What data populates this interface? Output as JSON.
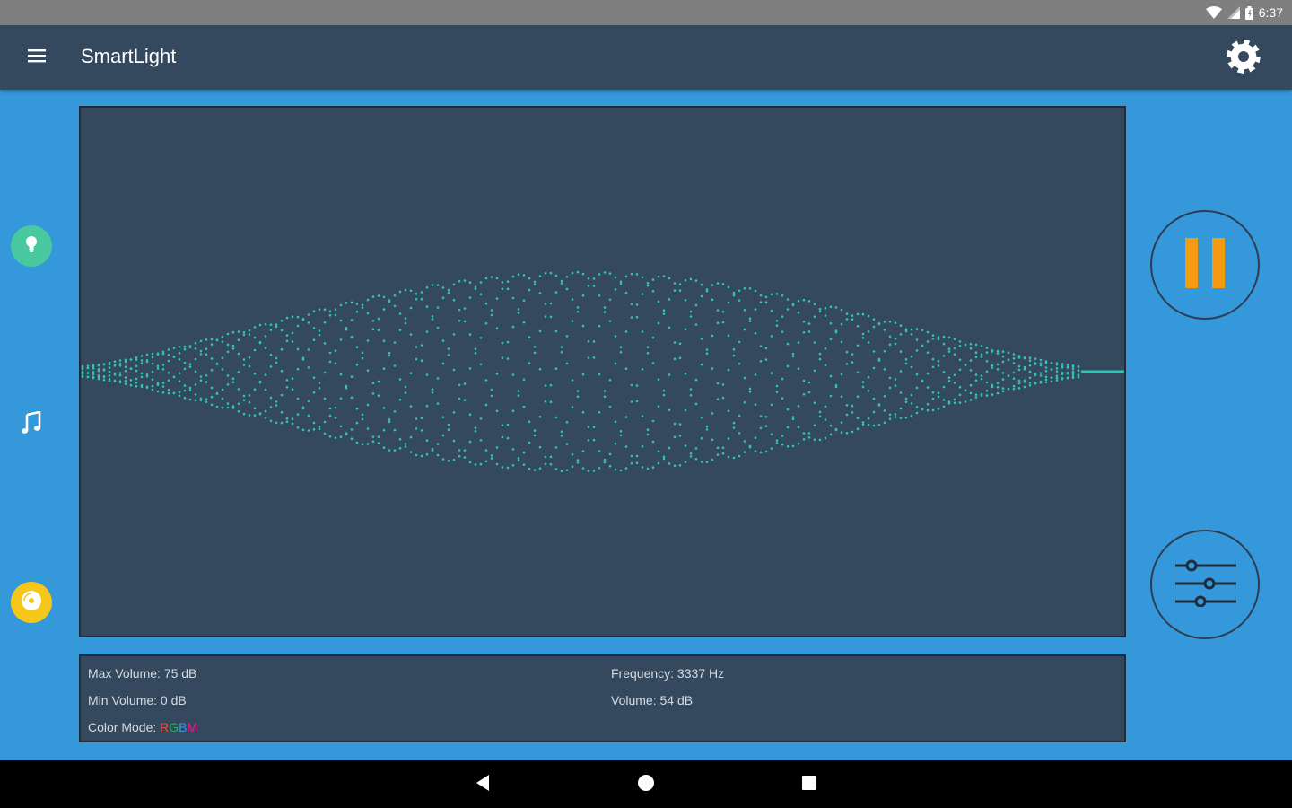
{
  "status_bar": {
    "time": "6:37",
    "icons": [
      "wifi-icon",
      "signal-icon",
      "battery-icon"
    ]
  },
  "app_bar": {
    "title": "SmartLight",
    "menu_icon": "hamburger-menu-icon",
    "settings_icon": "gear-icon"
  },
  "side_nav": [
    {
      "icon": "lightbulb-icon",
      "color": "#48c9a0"
    },
    {
      "icon": "music-note-icon",
      "color": "#ffffff"
    },
    {
      "icon": "disc-icon",
      "color": "#f5c71a"
    }
  ],
  "visualizer": {
    "wave_color": "#2ec4b6",
    "background": "#34495e"
  },
  "controls": {
    "pause_icon": "pause-icon",
    "pause_color": "#f39c12",
    "equalizer_icon": "equalizer-sliders-icon"
  },
  "info": {
    "max_volume": "Max Volume: 75 dB",
    "min_volume": "Min Volume: 0 dB",
    "color_mode_label": "Color Mode: ",
    "color_mode_parts": [
      "R",
      "G",
      "B",
      "M"
    ],
    "frequency": "Frequency: 3337 Hz",
    "volume": "Volume: 54 dB"
  },
  "nav_bar": {
    "icons": [
      "back-icon",
      "home-icon",
      "recents-icon"
    ]
  },
  "colors": {
    "app_bar": "#34495e",
    "background": "#3498db",
    "status_bar": "#7f7f7f"
  }
}
